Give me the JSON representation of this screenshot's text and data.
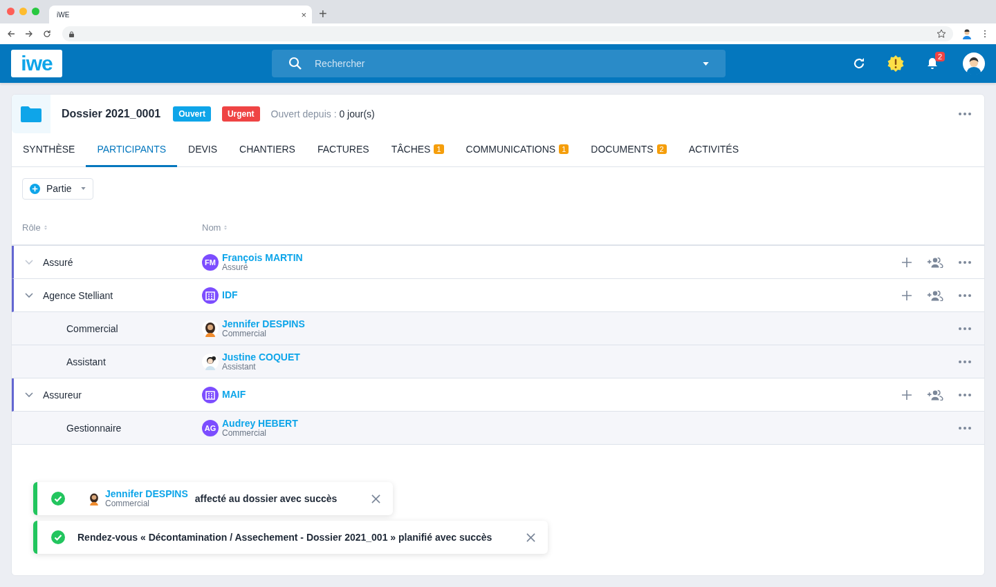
{
  "browser": {
    "tab_title": "iWE",
    "tab_close": "×",
    "new_tab": "+"
  },
  "header": {
    "logo": "iwe",
    "search_placeholder": "Rechercher",
    "notification_count": "2"
  },
  "dossier": {
    "title": "Dossier 2021_0001",
    "badges": [
      {
        "label": "Ouvert",
        "color": "#0ea5e9"
      },
      {
        "label": "Urgent",
        "color": "#ef4444"
      }
    ],
    "opened_label": "Ouvert depuis : ",
    "opened_value": "0 jour(s)"
  },
  "tabs": [
    {
      "label": "SYNTHÈSE",
      "selected": false
    },
    {
      "label": "PARTICIPANTS",
      "selected": true
    },
    {
      "label": "DEVIS",
      "selected": false
    },
    {
      "label": "CHANTIERS",
      "selected": false
    },
    {
      "label": "FACTURES",
      "selected": false
    },
    {
      "label": "TÂCHES",
      "count": "1",
      "selected": false
    },
    {
      "label": "COMMUNICATIONS",
      "count": "1",
      "selected": false
    },
    {
      "label": "DOCUMENTS",
      "count": "2",
      "selected": false
    },
    {
      "label": "ACTIVITÉS",
      "selected": false
    }
  ],
  "add_button": "Partie",
  "columns": [
    "Rôle",
    "Nom"
  ],
  "rows": [
    {
      "role": "Assuré",
      "participant": {
        "kind": "initials",
        "initials": "FM",
        "name": "François MARTIN",
        "subtitle": "Assuré"
      }
    },
    {
      "role": "Agence Stelliant",
      "participant": {
        "kind": "org",
        "name": "IDF"
      },
      "children": [
        {
          "role": "Commercial",
          "participant": {
            "kind": "person-curly",
            "name": "Jennifer DESPINS",
            "subtitle": "Commercial"
          }
        },
        {
          "role": "Assistant",
          "participant": {
            "kind": "person-bun",
            "name": "Justine COQUET",
            "subtitle": "Assistant"
          }
        }
      ]
    },
    {
      "role": "Assureur",
      "participant": {
        "kind": "org",
        "name": "MAIF"
      },
      "children": [
        {
          "role": "Gestionnaire",
          "participant": {
            "kind": "initials",
            "initials": "AG",
            "name": "Audrey HEBERT",
            "subtitle": "Commercial"
          }
        }
      ]
    }
  ],
  "toasts": [
    {
      "kind": "person",
      "name": "Jennifer DESPINS",
      "subtitle": "Commercial",
      "text": "affecté au dossier avec succès"
    },
    {
      "kind": "text",
      "text": "Rendez-vous « Décontamination / Assechement - Dossier 2021_001 » planifié avec succès"
    }
  ]
}
